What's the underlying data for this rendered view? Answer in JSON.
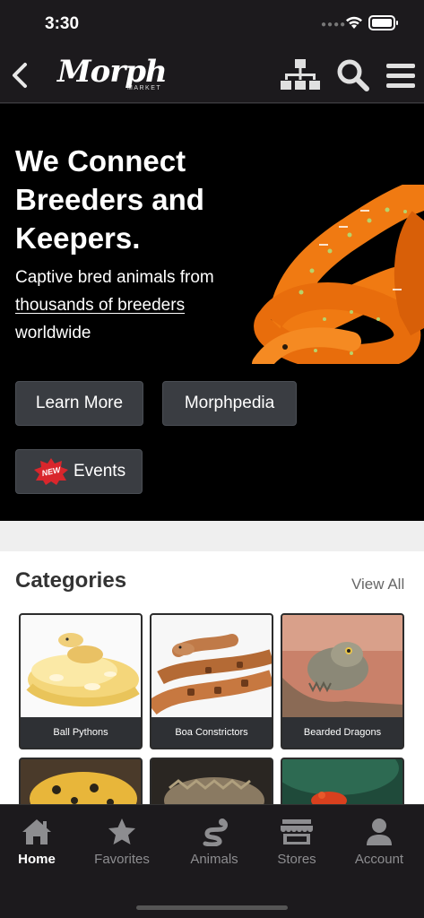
{
  "status_bar": {
    "time": "3:30"
  },
  "header": {
    "logo_text": "Morph",
    "logo_sub": "MARKET"
  },
  "hero": {
    "title": "We Connect Breeders and Keepers.",
    "subtitle_before": "Captive bred animals from",
    "subtitle_link": "thousands of breeders",
    "subtitle_after": "worldwide",
    "learn_more": "Learn More",
    "morphpedia": "Morphpedia",
    "events": "Events",
    "new_badge": "NEW"
  },
  "categories": {
    "title": "Categories",
    "view_all": "View All",
    "items": [
      {
        "label": "Ball Pythons"
      },
      {
        "label": "Boa Constrictors"
      },
      {
        "label": "Bearded Dragons"
      },
      {
        "label": ""
      },
      {
        "label": ""
      },
      {
        "label": ""
      }
    ]
  },
  "tabs": [
    {
      "label": "Home",
      "icon": "home-icon",
      "active": true
    },
    {
      "label": "Favorites",
      "icon": "star-icon",
      "active": false
    },
    {
      "label": "Animals",
      "icon": "snake-icon",
      "active": false
    },
    {
      "label": "Stores",
      "icon": "store-icon",
      "active": false
    },
    {
      "label": "Account",
      "icon": "user-icon",
      "active": false
    }
  ],
  "colors": {
    "background": "#1c1a1d",
    "hero_background": "#000000",
    "button": "#3a3d42",
    "snake_orange": "#f07a12",
    "new_badge": "#d9262c"
  }
}
